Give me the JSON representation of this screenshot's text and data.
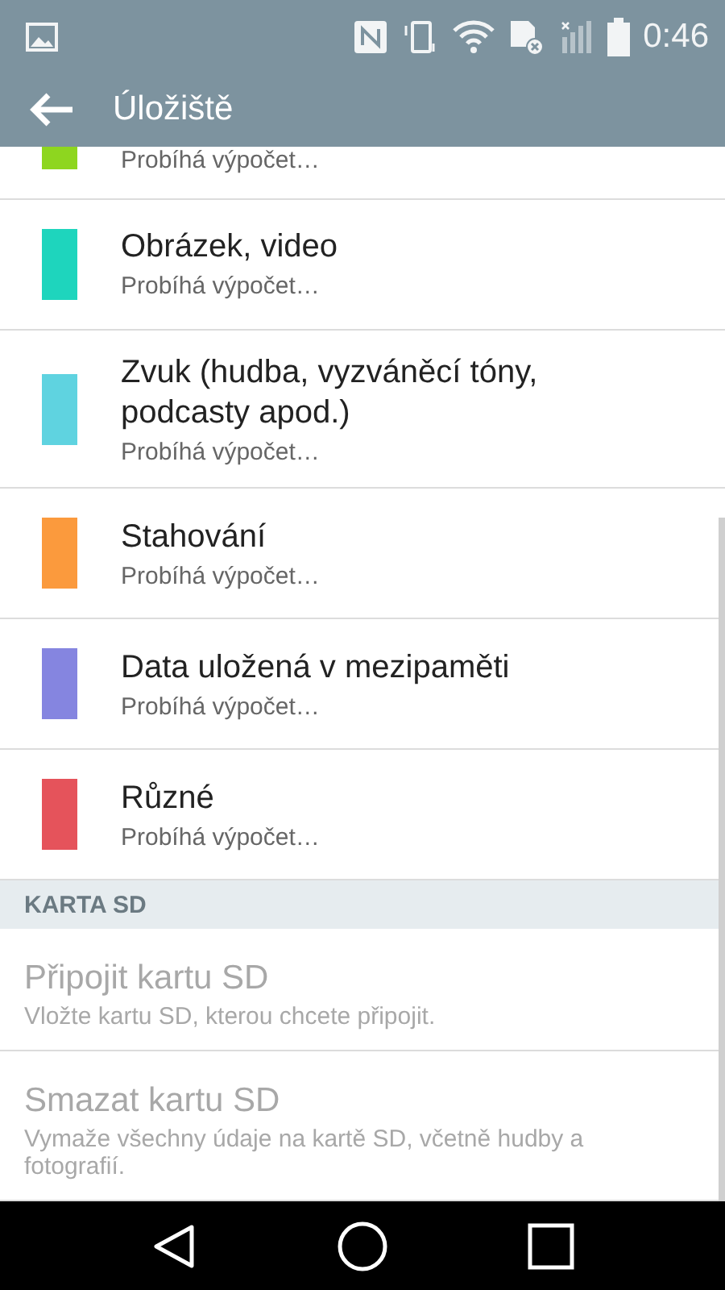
{
  "status_bar": {
    "time": "0:46"
  },
  "app_bar": {
    "title": "Úložiště"
  },
  "categories": [
    {
      "subtitle": "Probíhá výpočet…",
      "color": "#8ed61f"
    },
    {
      "title": "Obrázek, video",
      "subtitle": "Probíhá výpočet…",
      "color": "#1ed5bd"
    },
    {
      "title": "Zvuk (hudba, vyzváněcí tóny, podcasty apod.)",
      "subtitle": "Probíhá výpočet…",
      "color": "#5fd3e0"
    },
    {
      "title": "Stahování",
      "subtitle": "Probíhá výpočet…",
      "color": "#fb9a3d"
    },
    {
      "title": "Data uložená v mezipaměti",
      "subtitle": "Probíhá výpočet…",
      "color": "#8585e0"
    },
    {
      "title": "Různé",
      "subtitle": "Probíhá výpočet…",
      "color": "#e5535b"
    }
  ],
  "sections": [
    {
      "header": "KARTA SD",
      "items": [
        {
          "title": "Připojit kartu SD",
          "subtitle": "Vložte kartu SD, kterou chcete připojit.",
          "disabled": true
        },
        {
          "title": "Smazat kartu SD",
          "subtitle": "Vymaže všechny údaje na kartě SD, včetně hudby a fotografií.",
          "disabled": true
        }
      ]
    }
  ]
}
